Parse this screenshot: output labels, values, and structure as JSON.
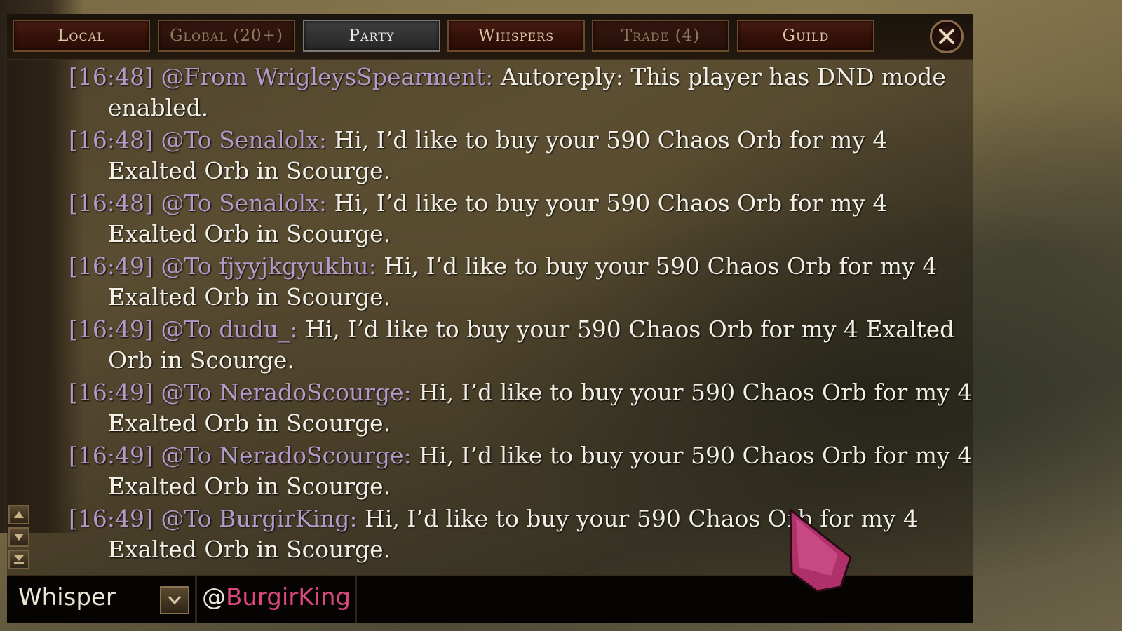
{
  "tabs": [
    {
      "label": "Local"
    },
    {
      "label": "Global (20+)"
    },
    {
      "label": "Party"
    },
    {
      "label": "Whispers"
    },
    {
      "label": "Trade (4)"
    },
    {
      "label": "Guild"
    }
  ],
  "active_tab": "Party",
  "messages": [
    {
      "time": "[16:48]",
      "direction": "@From",
      "sender": "WrigleysSpearment:",
      "text": "Autoreply: This player has DND mode enabled."
    },
    {
      "time": "[16:48]",
      "direction": "@To",
      "sender": "Senalolx:",
      "text": "Hi, I’d like to buy your 590 Chaos Orb for my 4 Exalted Orb in Scourge."
    },
    {
      "time": "[16:48]",
      "direction": "@To",
      "sender": "Senalolx:",
      "text": "Hi, I’d like to buy your 590 Chaos Orb for my 4 Exalted Orb in Scourge."
    },
    {
      "time": "[16:49]",
      "direction": "@To",
      "sender": "fjyyjkgyukhu:",
      "text": "Hi, I’d like to buy your 590 Chaos Orb for my 4 Exalted Orb in Scourge."
    },
    {
      "time": "[16:49]",
      "direction": "@To",
      "sender": "dudu_:",
      "text": "Hi, I’d like to buy your 590 Chaos Orb for my 4 Exalted Orb in Scourge."
    },
    {
      "time": "[16:49]",
      "direction": "@To",
      "sender": "NeradoScourge:",
      "text": "Hi, I’d like to buy your 590 Chaos Orb for my 4 Exalted Orb in Scourge."
    },
    {
      "time": "[16:49]",
      "direction": "@To",
      "sender": "NeradoScourge:",
      "text": "Hi, I’d like to buy your 590 Chaos Orb for my 4 Exalted Orb in Scourge."
    },
    {
      "time": "[16:49]",
      "direction": "@To",
      "sender": "BurgirKing:",
      "text": "Hi, I’d like to buy your 590 Chaos Orb for my 4 Exalted Orb in Scourge."
    }
  ],
  "input": {
    "channel": "Whisper",
    "at": "@",
    "target": "BurgirKing",
    "value": ""
  },
  "colors": {
    "meta": "#b39ac7",
    "target_name": "#d9477f",
    "message_text": "#f2efe6"
  },
  "icons": {
    "close": "close-x-icon",
    "scroll_up": "scroll-up-icon",
    "scroll_down": "scroll-down-icon",
    "scroll_bottom": "scroll-to-bottom-icon",
    "channel_dropdown": "chevron-down-icon",
    "cursor": "mouse-cursor-icon"
  }
}
